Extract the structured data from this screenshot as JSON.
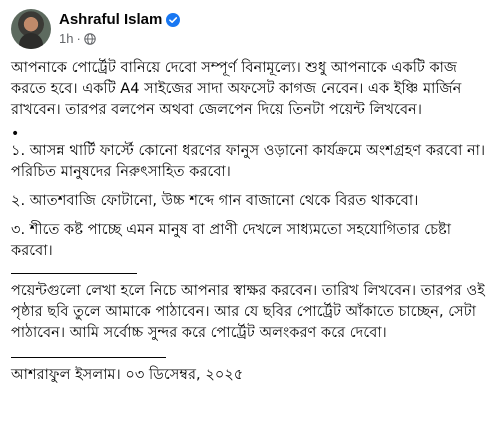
{
  "post": {
    "author": "Ashraful Islam",
    "time": "1h",
    "separator": "·",
    "icons": {
      "verified": "verified-badge-icon",
      "audience": "globe-icon",
      "accent": "#1877f2",
      "muted": "#65676b"
    },
    "body": {
      "intro": "আপনাকে পোর্ট্রেট বানিয়ে দেবো সম্পূর্ণ বিনামূল্যে। শুধু আপনাকে একটি কাজ করতে হবে। একটি A4 সাইজের সাদা অফসেট কাগজ নেবেন। এক ইঞ্চি মার্জিন রাখবেন। তারপর বলপেন অথবা জেলপেন দিয়ে তিনটা পয়েন্ট লিখবেন।",
      "bullet": "•",
      "point1": "১. আসন্ন থার্টি ফার্স্টে কোনো ধরণের ফানুস ওড়ানো কার্যক্রমে অংশগ্রহণ করবো না। পরিচিত মানুষদের নিরুৎসাহিত করবো।",
      "point2": "২. আতশবাজি ফোটানো, উচ্চ শব্দে গান বাজানো থেকে বিরত থাকবো।",
      "point3": "৩. শীতে কষ্ট পাচ্ছে এমন মানুষ বা প্রাণী দেখলে সাধ্যমতো সহযোগিতার চেষ্টা করবো।",
      "instructions": "পয়েন্টগুলো লেখা হলে নিচে আপনার স্বাক্ষর করবেন। তারিখ লিখবেন। তারপর ওই পৃষ্ঠার ছবি তুলে আমাকে পাঠাবেন। আর যে ছবির পোর্ট্রেট আঁকাতে চাচ্ছেন, সেটা পাঠাবেন। আমি সর্বোচ্চ সুন্দর করে পোর্ট্রেট অলংকরণ করে দেবো।",
      "signature": "আশরাফুল ইসলাম। ০৩ ডিসেম্বর, ২০২৫"
    }
  }
}
